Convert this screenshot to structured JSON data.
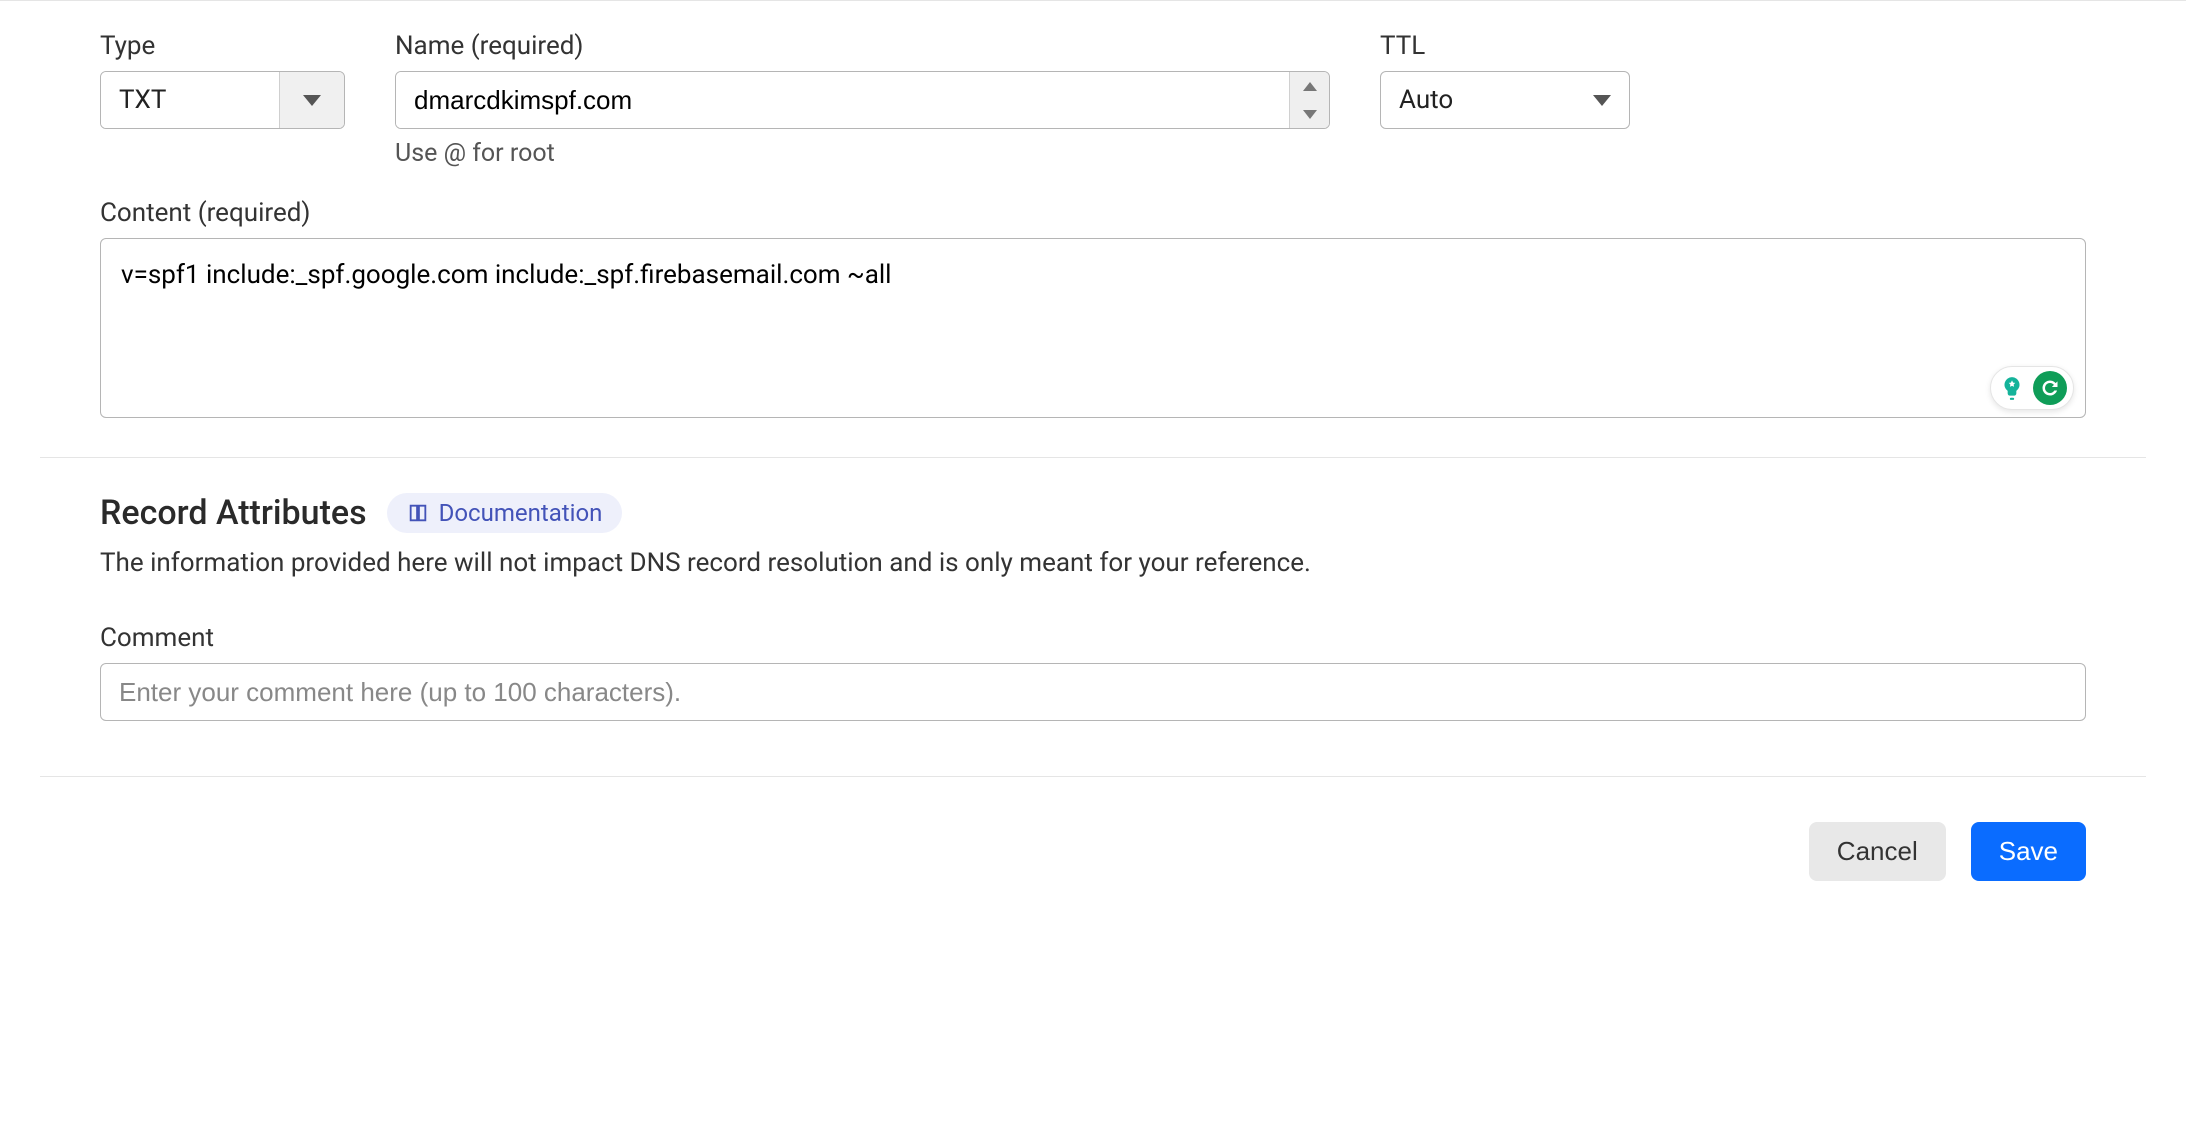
{
  "type": {
    "label": "Type",
    "value": "TXT"
  },
  "name": {
    "label": "Name (required)",
    "value": "dmarcdkimspf.com",
    "helper": "Use @ for root"
  },
  "ttl": {
    "label": "TTL",
    "value": "Auto"
  },
  "content": {
    "label": "Content (required)",
    "value": "v=spf1 include:_spf.google.com include:_spf.firebasemail.com ~all"
  },
  "attributes": {
    "title": "Record Attributes",
    "doc_link": "Documentation",
    "description": "The information provided here will not impact DNS record resolution and is only meant for your reference."
  },
  "comment": {
    "label": "Comment",
    "placeholder": "Enter your comment here (up to 100 characters)."
  },
  "buttons": {
    "cancel": "Cancel",
    "save": "Save"
  }
}
